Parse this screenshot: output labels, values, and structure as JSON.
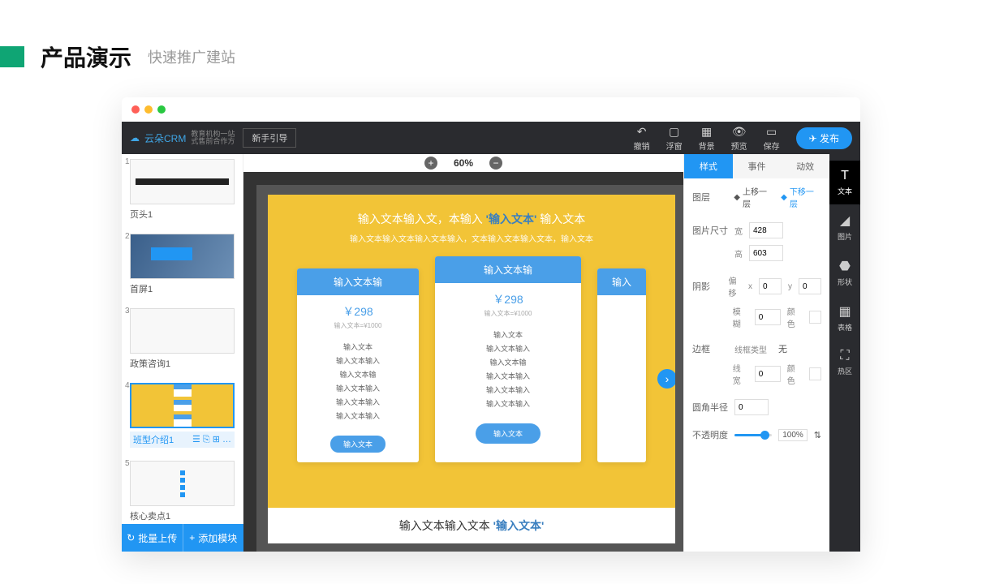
{
  "header": {
    "title": "产品演示",
    "subtitle": "快速推广建站"
  },
  "toolbar": {
    "brand": "云朵CRM",
    "brand_sub1": "教育机构一站",
    "brand_sub2": "式售前合作方",
    "guide": "新手引导",
    "undo": "撤销",
    "float": "浮窗",
    "bg": "背景",
    "preview": "预览",
    "save": "保存",
    "publish": "发布"
  },
  "zoom": {
    "value": "60%"
  },
  "pages": {
    "items": [
      {
        "num": "1",
        "label": "页头1"
      },
      {
        "num": "2",
        "label": "首屏1"
      },
      {
        "num": "3",
        "label": "政策咨询1"
      },
      {
        "num": "4",
        "label": "班型介绍1"
      },
      {
        "num": "5",
        "label": "核心卖点1"
      }
    ],
    "batch_upload": "批量上传",
    "add_module": "添加模块"
  },
  "canvas": {
    "title_pre": "输入文本输入文，本输入",
    "title_em": "'输入文本'",
    "title_post": "输入文本",
    "subtitle": "输入文本输入文本输入文本输入，文本输入文本输入文本，输入文本",
    "cards": [
      {
        "head": "输入文本输",
        "price": "￥298",
        "price_sub": "输入文本=¥1000",
        "list": [
          "输入文本",
          "输入文本输入",
          "输入文本输",
          "输入文本输入",
          "输入文本输入",
          "输入文本输入"
        ],
        "btn": "输入文本"
      },
      {
        "head": "输入文本输",
        "price": "￥298",
        "price_sub": "输入文本=¥1000",
        "list": [
          "输入文本",
          "输入文本输入",
          "输入文本输",
          "输入文本输入",
          "输入文本输入",
          "输入文本输入"
        ],
        "btn": "输入文本"
      },
      {
        "head": "输入"
      }
    ],
    "bottom_pre": "输入文本输入文本",
    "bottom_em": "'输入文本'"
  },
  "props": {
    "tabs": {
      "style": "样式",
      "event": "事件",
      "anim": "动效"
    },
    "layer": {
      "label": "图层",
      "up": "上移一层",
      "down": "下移一层"
    },
    "size": {
      "label": "图片尺寸",
      "w_label": "宽",
      "w": "428",
      "h_label": "高",
      "h": "603"
    },
    "shadow": {
      "label": "阴影",
      "offset": "偏移",
      "x_label": "x",
      "x": "0",
      "y_label": "y",
      "y": "0",
      "blur_label": "模糊",
      "blur": "0",
      "color_label": "颜色"
    },
    "border": {
      "label": "边框",
      "type_label": "线框类型",
      "type": "无",
      "width_label": "线宽",
      "width": "0",
      "color_label": "颜色"
    },
    "radius": {
      "label": "圆角半径",
      "value": "0"
    },
    "opacity": {
      "label": "不透明度",
      "value": "100%"
    }
  },
  "rail": {
    "text": "文本",
    "image": "图片",
    "shape": "形状",
    "table": "表格",
    "hot": "热区"
  }
}
